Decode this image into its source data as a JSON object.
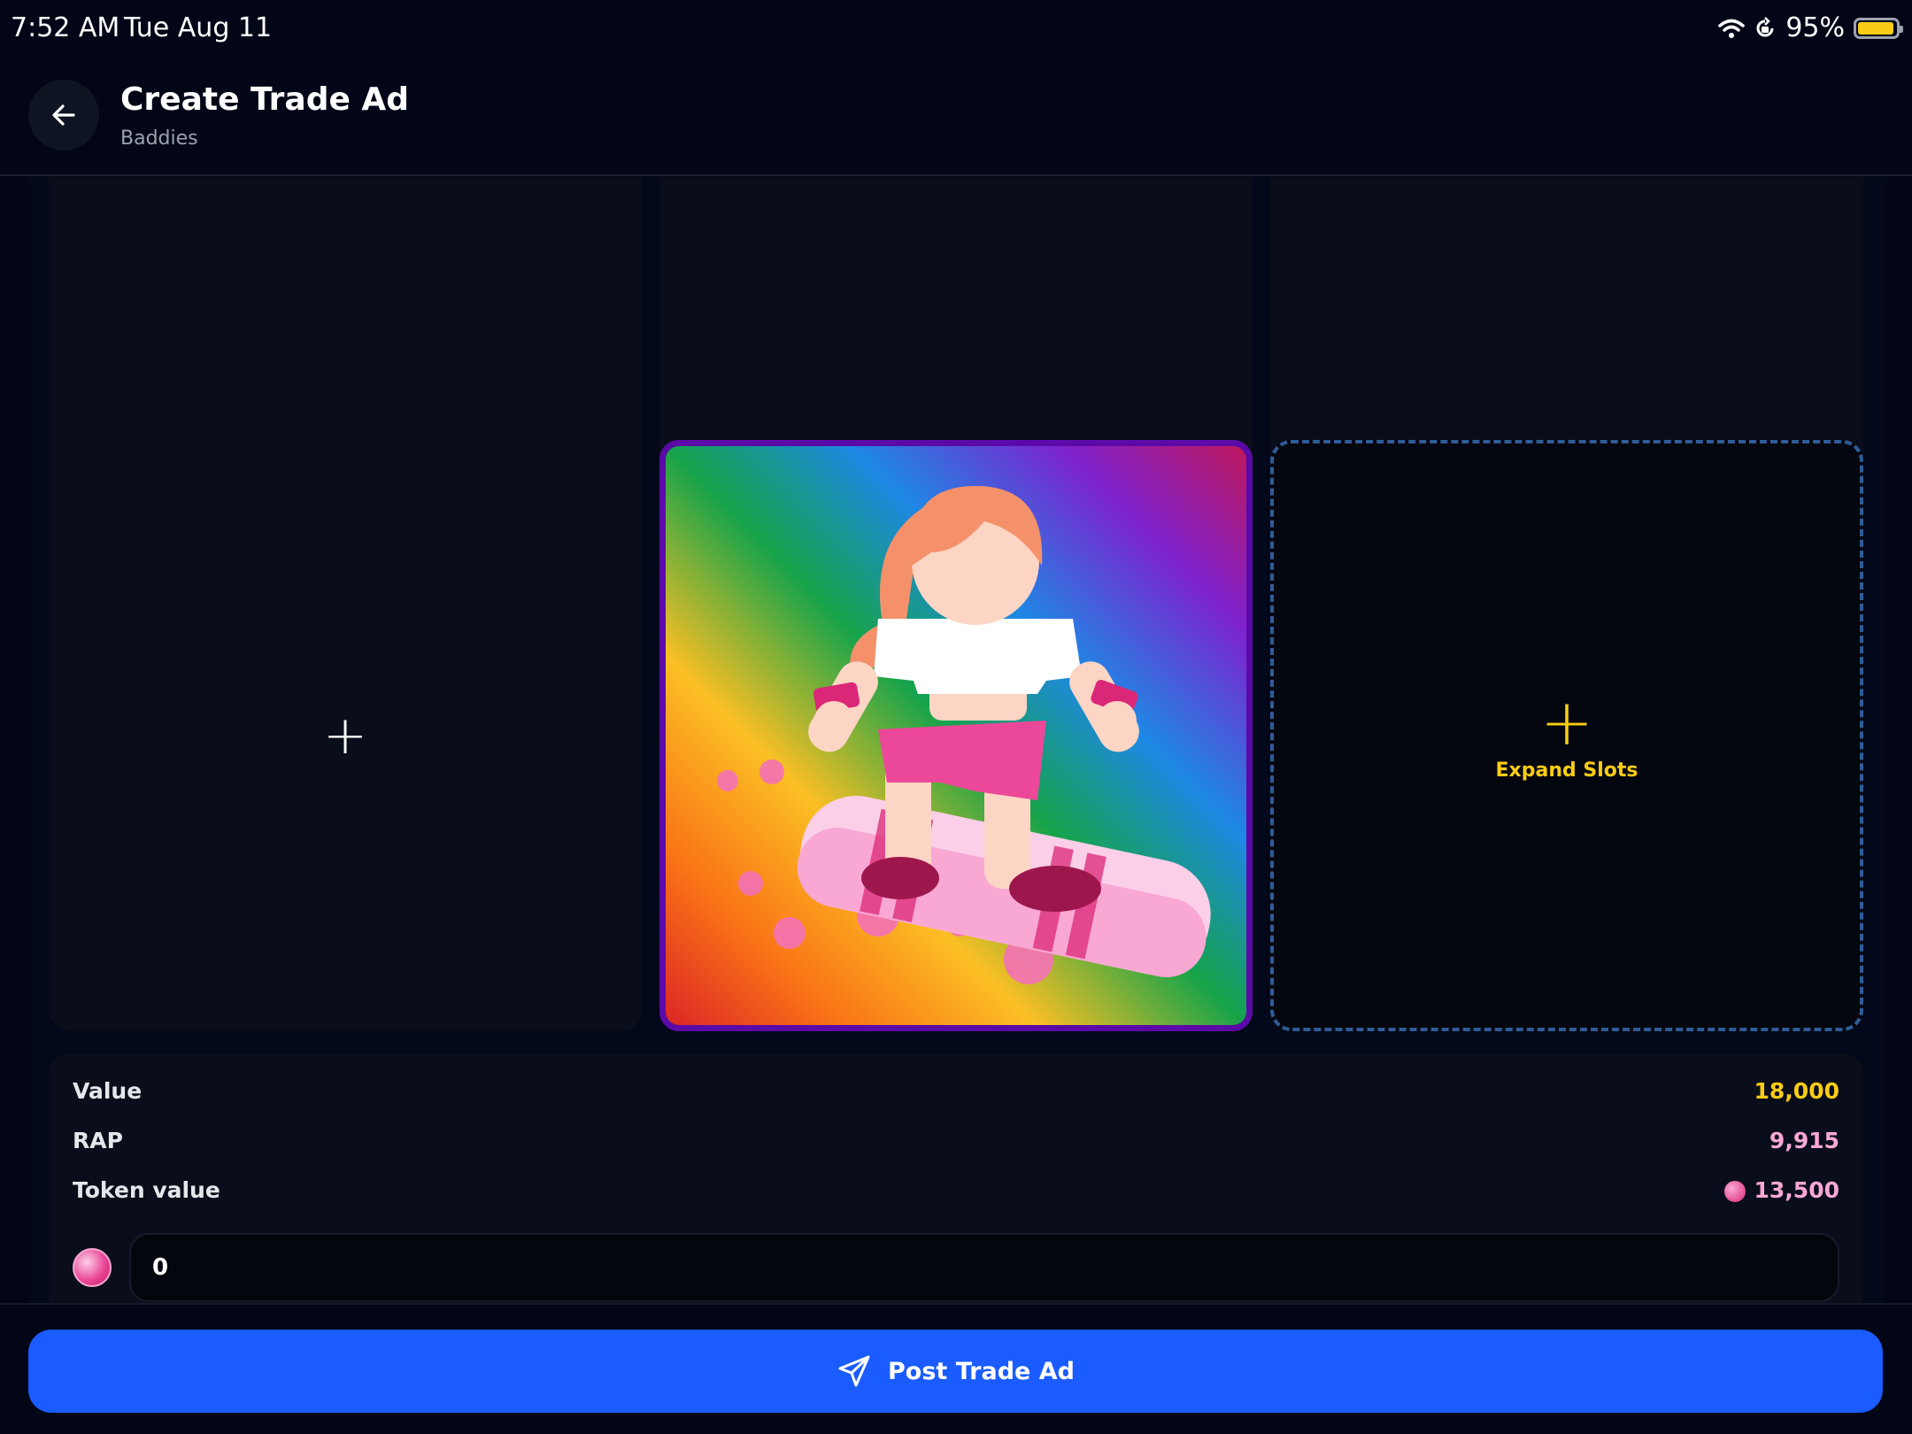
{
  "status_bar": {
    "time": "7:52 AM",
    "date": "Tue Aug 11",
    "battery_percent": "95%",
    "battery_level": 0.95,
    "icons": [
      "wifi-icon",
      "orientation-lock-icon",
      "battery-icon"
    ]
  },
  "header": {
    "title": "Create Trade Ad",
    "subtitle": "Baddies",
    "back_icon": "arrow-left-icon"
  },
  "slots": {
    "add_icon": "plus-icon",
    "item_name": "skateboard-girl-item",
    "expand_label": "Expand Slots"
  },
  "stats": {
    "value_label": "Value",
    "value": "18,000",
    "rap_label": "RAP",
    "rap": "9,915",
    "token_label": "Token value",
    "token_value": "13,500"
  },
  "token_input": {
    "value": "0"
  },
  "footer": {
    "post_label": "Post Trade Ad",
    "post_icon": "send-icon"
  },
  "colors": {
    "accent_blue": "#1a5cff",
    "gold": "#facc15",
    "pink": "#f9a8d4",
    "item_border": "#5b0aa8"
  }
}
